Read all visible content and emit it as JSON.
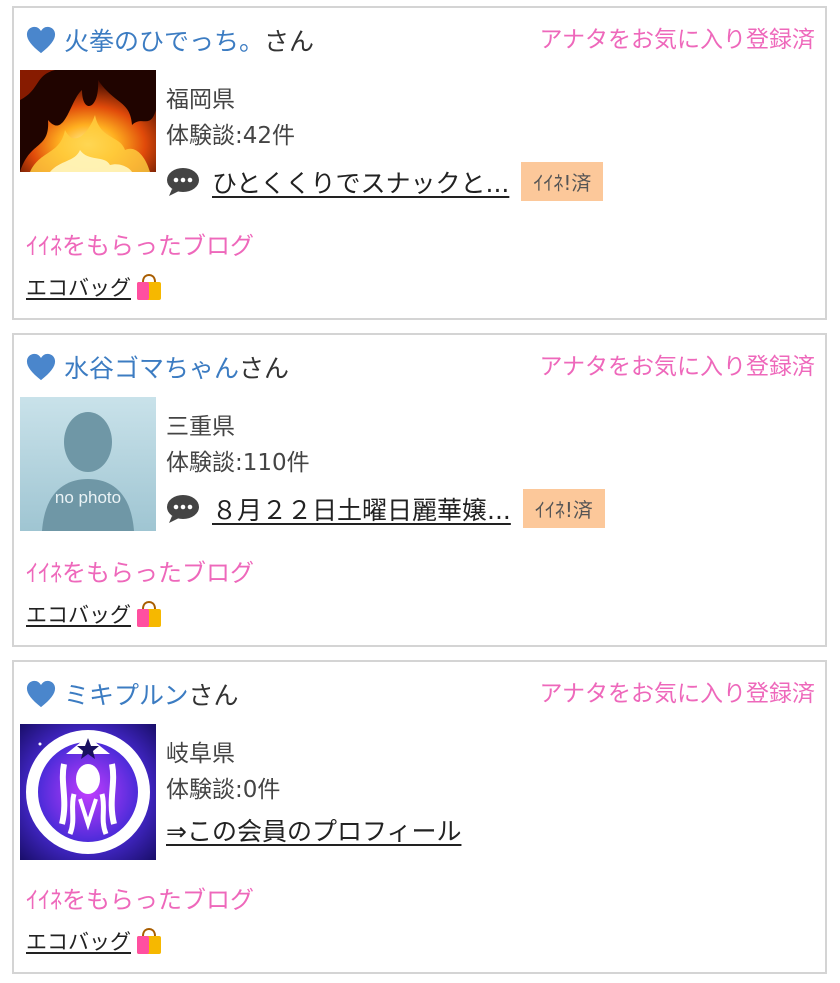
{
  "members": [
    {
      "name": "火拳のひでっち。",
      "suffix": "さん",
      "favorite_status": "アナタをお気に入り登録済",
      "prefecture": "福岡県",
      "reviews": "体験談:42件",
      "post_title": "ひとくくりでスナックと...",
      "like_badge": "ｲｲﾈ!済",
      "liked_blog_label": "ｲｲﾈをもらったブログ",
      "eco_bag_label": "エコバッグ",
      "avatar": "fire-image"
    },
    {
      "name": "水谷ゴマちゃん",
      "suffix": "さん",
      "favorite_status": "アナタをお気に入り登録済",
      "prefecture": "三重県",
      "reviews": "体験談:110件",
      "post_title": "８月２２日土曜日麗華嬢...",
      "like_badge": "ｲｲﾈ!済",
      "liked_blog_label": "ｲｲﾈをもらったブログ",
      "eco_bag_label": "エコバッグ",
      "avatar": "no-photo-silhouette",
      "avatar_text": "no photo"
    },
    {
      "name": "ミキプルン",
      "suffix": "さん",
      "favorite_status": "アナタをお気に入り登録済",
      "prefecture": "岐阜県",
      "reviews": "体験談:0件",
      "profile_link": "⇒この会員のプロフィール",
      "liked_blog_label": "ｲｲﾈをもらったブログ",
      "eco_bag_label": "エコバッグ",
      "avatar": "siren-logo-image"
    }
  ],
  "colors": {
    "name": "#3c7cc2",
    "pink": "#ee68bb",
    "badge_bg": "#fcc89a",
    "border": "#d4d4d4"
  },
  "icons": [
    "heart-icon",
    "speech-bubble-icon",
    "shopping-bag-icon"
  ]
}
